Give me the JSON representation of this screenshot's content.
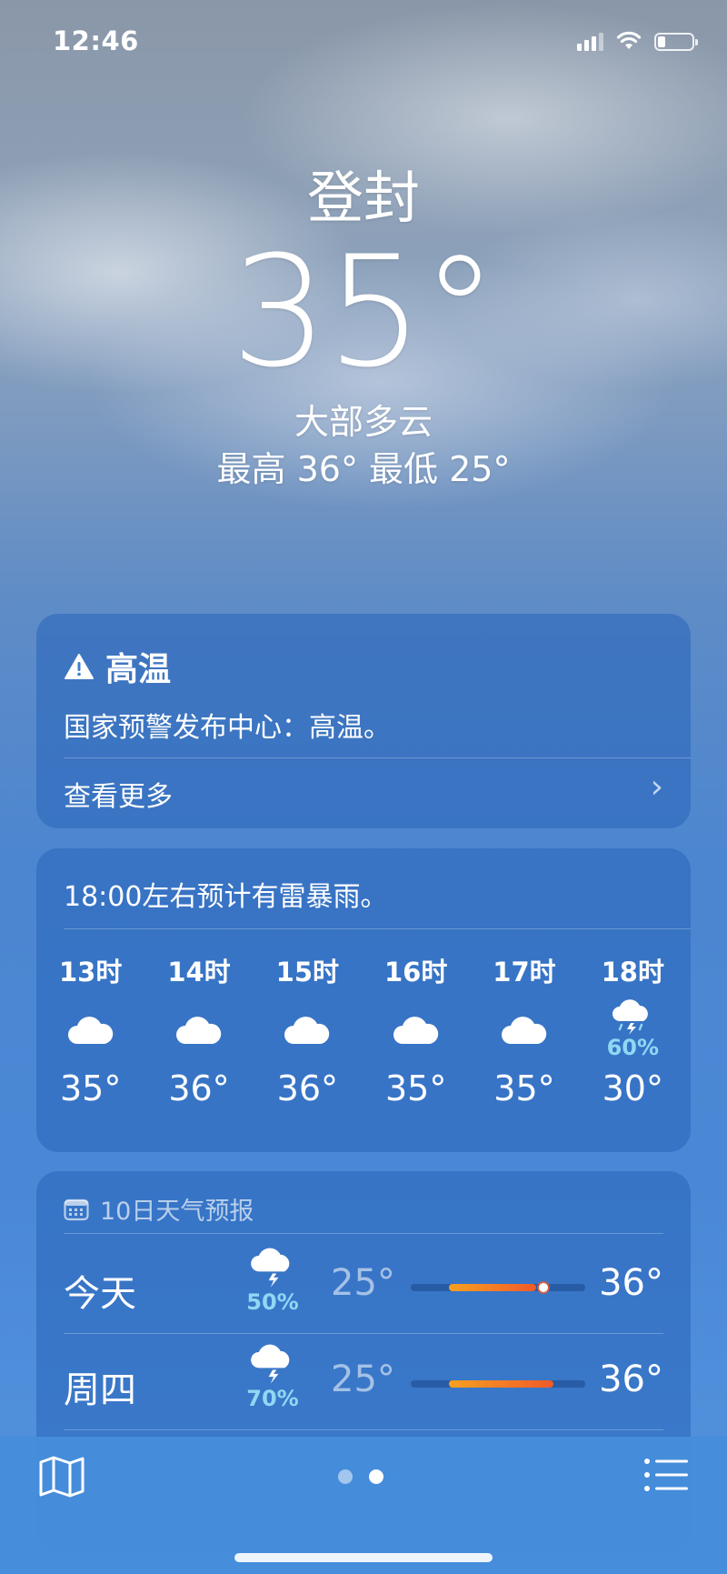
{
  "status_bar": {
    "time": "12:46"
  },
  "current": {
    "city": "登封",
    "temperature": "35°",
    "condition": "大部多云",
    "high_low": "最高 36° 最低 25°"
  },
  "alert": {
    "title": "高温",
    "body": "国家预警发布中心：高温。",
    "more_label": "查看更多"
  },
  "hourly": {
    "summary": "18:00左右预计有雷暴雨。",
    "hours": [
      {
        "label": "13时",
        "icon": "cloud-icon",
        "precip": "",
        "temp": "35°"
      },
      {
        "label": "14时",
        "icon": "cloud-icon",
        "precip": "",
        "temp": "36°"
      },
      {
        "label": "15时",
        "icon": "cloud-icon",
        "precip": "",
        "temp": "36°"
      },
      {
        "label": "16时",
        "icon": "cloud-icon",
        "precip": "",
        "temp": "35°"
      },
      {
        "label": "17时",
        "icon": "cloud-icon",
        "precip": "",
        "temp": "35°"
      },
      {
        "label": "18时",
        "icon": "thunderstorm-icon",
        "precip": "60%",
        "temp": "30°"
      }
    ]
  },
  "daily": {
    "header": "10日天气预报",
    "days": [
      {
        "name": "今天",
        "icon": "thunderstorm-icon",
        "precip": "50%",
        "low": "25°",
        "high": "36°",
        "range_start": 0.22,
        "range_end": 0.72,
        "current_marker": 0.76
      },
      {
        "name": "周四",
        "icon": "thunderstorm-icon",
        "precip": "70%",
        "low": "25°",
        "high": "36°",
        "range_start": 0.22,
        "range_end": 0.82
      }
    ]
  },
  "toolbar": {
    "pages": 2,
    "active_page": 2
  },
  "colors": {
    "precip": "#8fd8f4",
    "bar_start": "#f7a020",
    "bar_end": "#f05a2a"
  }
}
